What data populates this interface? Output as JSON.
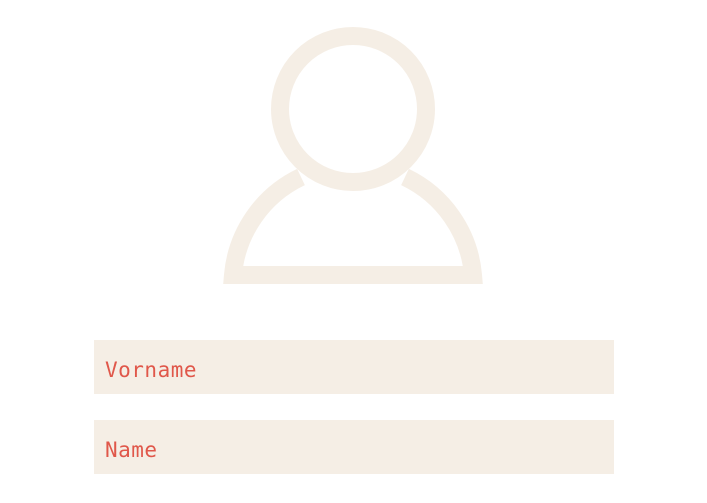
{
  "avatar": {
    "icon": "user-icon",
    "color": "#f5eee5"
  },
  "form": {
    "fields": [
      {
        "placeholder": "Vorname",
        "value": ""
      },
      {
        "placeholder": "Name",
        "value": ""
      }
    ],
    "field_background": "#f5eee5",
    "placeholder_color": "#e0574a"
  }
}
